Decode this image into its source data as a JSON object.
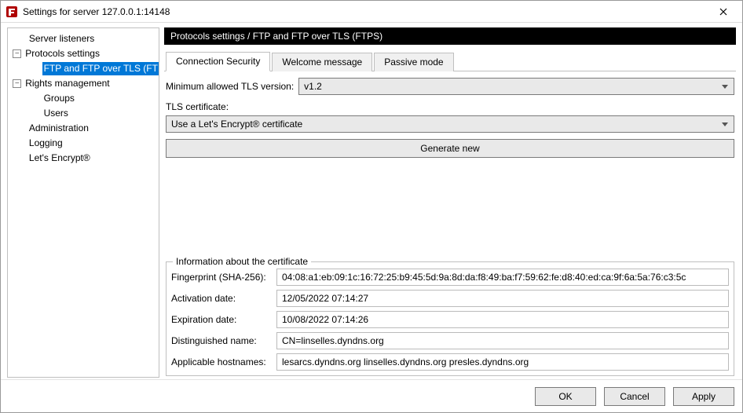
{
  "window": {
    "title": "Settings for server 127.0.0.1:14148"
  },
  "tree": {
    "server_listeners": "Server listeners",
    "protocols_settings": "Protocols settings",
    "ftp_ftps": "FTP and FTP over TLS (FTPS)",
    "rights_management": "Rights management",
    "groups": "Groups",
    "users": "Users",
    "administration": "Administration",
    "logging": "Logging",
    "lets_encrypt": "Let's Encrypt®"
  },
  "breadcrumb": "Protocols settings / FTP and FTP over TLS (FTPS)",
  "tabs": {
    "connection_security": "Connection Security",
    "welcome_message": "Welcome message",
    "passive_mode": "Passive mode"
  },
  "form": {
    "min_tls_label": "Minimum allowed TLS version:",
    "min_tls_value": "v1.2",
    "tls_cert_label": "TLS certificate:",
    "tls_cert_value": "Use a Let's Encrypt® certificate",
    "generate_new": "Generate new"
  },
  "cert_info": {
    "legend": "Information about the certificate",
    "fingerprint_label": "Fingerprint (SHA-256):",
    "fingerprint_value": "04:08:a1:eb:09:1c:16:72:25:b9:45:5d:9a:8d:da:f8:49:ba:f7:59:62:fe:d8:40:ed:ca:9f:6a:5a:76:c3:5c",
    "activation_label": "Activation date:",
    "activation_value": "12/05/2022 07:14:27",
    "expiration_label": "Expiration date:",
    "expiration_value": "10/08/2022 07:14:26",
    "dn_label": "Distinguished name:",
    "dn_value": "CN=linselles.dyndns.org",
    "hostnames_label": "Applicable hostnames:",
    "hostnames_value": "lesarcs.dyndns.org linselles.dyndns.org presles.dyndns.org"
  },
  "buttons": {
    "ok": "OK",
    "cancel": "Cancel",
    "apply": "Apply"
  }
}
